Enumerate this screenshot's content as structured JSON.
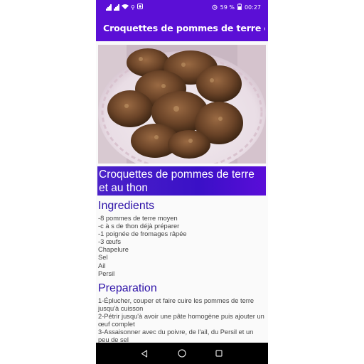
{
  "status_bar": {
    "left_indicators": "ᴺ",
    "battery": "59 %",
    "time": "00:27"
  },
  "app_bar": {
    "title": "Croquettes de pommes de terre et..."
  },
  "recipe": {
    "title": "Croquettes de pommes de terre et au thon",
    "ingredients_heading": "Ingredients",
    "ingredients": [
      "-8 pommes de terre moyen",
      "-c à s de thon déjà préparer",
      "-1 poignée de fromages râpée",
      "-3 œufs",
      "Chapelure",
      "Sel",
      "Ail",
      "Persil"
    ],
    "preparation_heading": "Preparation",
    "preparation": [
      "1-Éplucher, couper et faire cuire les pommes de terre jusqu'à cuisson",
      "2-Pétrir jusqu'à avoir une pâte homogène puis ajouter un œuf complet",
      "3-Assaisonner avec du poivre, de l'ail, du Persil et un peu de sel"
    ]
  },
  "colors": {
    "primary": "#5b0fd6",
    "title_bg": "#3a10c7",
    "heading": "#2d12a8"
  },
  "icons": [
    "signal-icon",
    "wifi-icon",
    "alarm-icon",
    "battery-icon",
    "back-icon",
    "home-icon",
    "recents-icon"
  ]
}
